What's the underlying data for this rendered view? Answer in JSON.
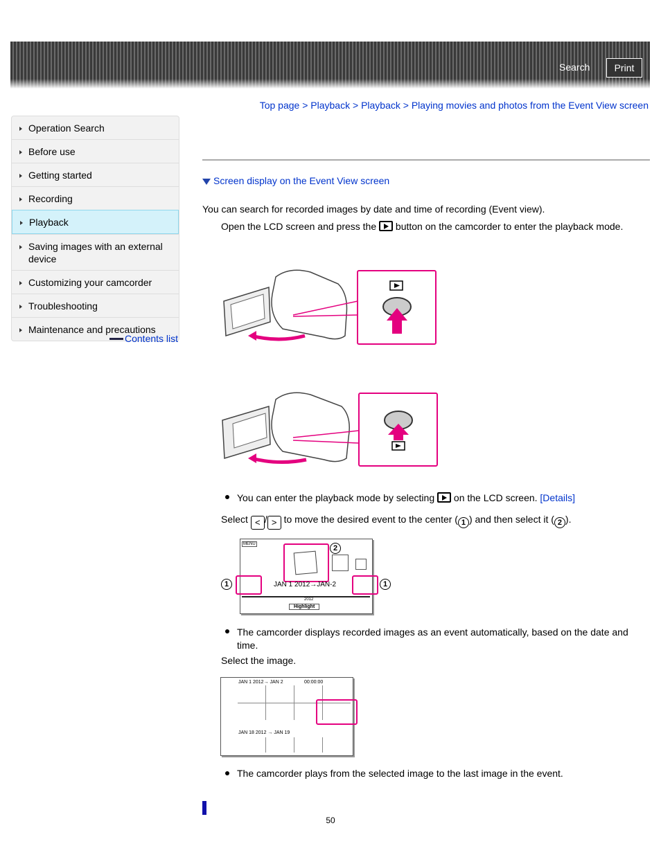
{
  "header": {
    "search_label": "Search",
    "print_label": "Print"
  },
  "breadcrumb": [
    "Top page",
    "Playback",
    "Playback",
    "Playing movies and photos from the Event View screen"
  ],
  "breadcrumb_sep": " > ",
  "sidebar": {
    "items": [
      {
        "label": "Operation Search"
      },
      {
        "label": "Before use"
      },
      {
        "label": "Getting started"
      },
      {
        "label": "Recording"
      },
      {
        "label": "Playback",
        "active": true
      },
      {
        "label": "Saving images with an external device"
      },
      {
        "label": "Customizing your camcorder"
      },
      {
        "label": "Troubleshooting"
      },
      {
        "label": "Maintenance and precautions"
      }
    ],
    "contents_link": "Contents list"
  },
  "main": {
    "section_link": "Screen display on the Event View screen",
    "intro": "You can search for recorded images by date and time of recording (Event view).",
    "step1_a": "Open the LCD screen and press the",
    "step1_b": "button on the camcorder to enter the playback mode.",
    "bullet1_a": "You can enter the playback mode by selecting",
    "bullet1_b": "on the LCD screen.",
    "bullet1_link": "[Details]",
    "step2_a": "Select",
    "step2_slash": "/",
    "step2_b": "to move the desired event to the center (",
    "step2_c": ") and then select it (",
    "step2_d": ").",
    "num1": "1",
    "num2": "2",
    "event_screen": {
      "menu": "MENU",
      "range": "JAN 1 2012→JAN-2",
      "year": "2012",
      "highlight": "Highlight"
    },
    "bullet2": "The camcorder displays recorded images as an event automatically, based on the date and time.",
    "step3": "Select the image.",
    "index_screen": {
      "event1": "JAN 1 2012→ JAN 2",
      "time": "00:00:00",
      "event2": "JAN 18 2012 → JAN 19"
    },
    "bullet3": "The camcorder plays from the selected image to the last image in the event.",
    "page_number": "50"
  },
  "colors": {
    "link": "#0033cc",
    "highlight": "#e4007f",
    "active_nav": "#d4f2fa"
  }
}
